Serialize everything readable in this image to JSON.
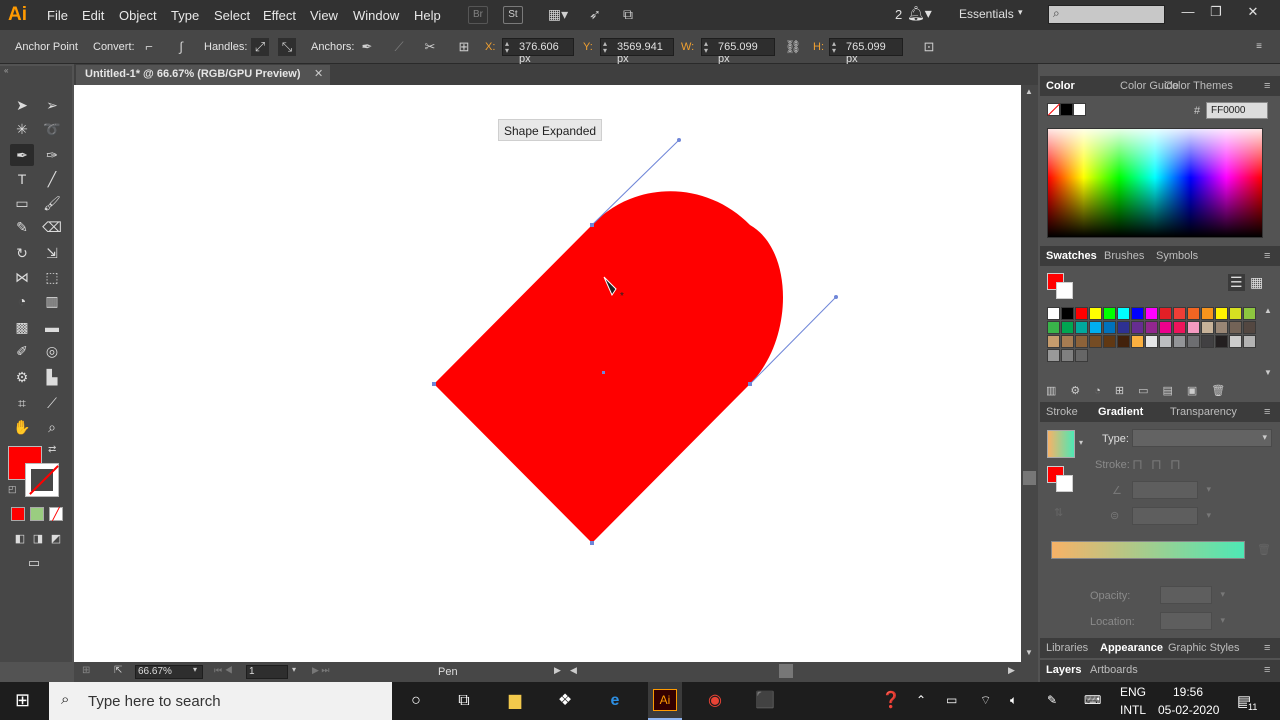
{
  "menubar": {
    "logo": "Ai",
    "items": [
      "File",
      "Edit",
      "Object",
      "Type",
      "Select",
      "Effect",
      "View",
      "Window",
      "Help"
    ],
    "icons": {
      "bridge": "Br",
      "stock": "St"
    },
    "notification_count": "2",
    "workspace": "Essentials",
    "window_controls": [
      "minimize-icon",
      "restore-icon",
      "close-icon"
    ]
  },
  "control": {
    "anchor_point": "Anchor Point",
    "convert_label": "Convert:",
    "handles_label": "Handles:",
    "anchors_label": "Anchors:",
    "x_label": "X:",
    "x_value": "376.606 px",
    "y_label": "Y:",
    "y_value": "3569.941 px",
    "w_label": "W:",
    "w_value": "765.099 px",
    "h_label": "H:",
    "h_value": "765.099 px"
  },
  "document": {
    "tab_title": "Untitled-1* @ 66.67% (RGB/GPU Preview)",
    "tooltip": "Shape Expanded",
    "shape_color": "#ff0000"
  },
  "statusbar": {
    "zoom": "66.67%",
    "artboard": "1",
    "tool": "Pen"
  },
  "color_panel": {
    "tabs": [
      "Color",
      "Color Guide",
      "Color Themes"
    ],
    "hex_label": "#",
    "hex_value": "FF0000"
  },
  "swatches_panel": {
    "tabs": [
      "Swatches",
      "Brushes",
      "Symbols"
    ],
    "colors": [
      "#ffffff",
      "#000000",
      "#ff0000",
      "#ffff00",
      "#00ff00",
      "#00ffff",
      "#0000ff",
      "#ff00ff",
      "#e41f26",
      "#ef3e36",
      "#f26522",
      "#f7941d",
      "#fff200",
      "#d7e021",
      "#8dc63f",
      "#39b54a",
      "#00a651",
      "#00a99d",
      "#00aeef",
      "#0072bc",
      "#2e3192",
      "#662d91",
      "#92278f",
      "#ec008c",
      "#ed145b",
      "#f49ac1",
      "#c7b299",
      "#998675",
      "#736357",
      "#534741",
      "#c69c6d",
      "#a67c52",
      "#8c6239",
      "#754c24",
      "#603813",
      "#42210b",
      "#fbb040",
      "#e6e7e8",
      "#bcbec0",
      "#939598",
      "#6d6e71",
      "#414042",
      "#231f20",
      "#cccccc",
      "#b3b3b3",
      "#999999",
      "#808080",
      "#666666"
    ]
  },
  "gradient_panel": {
    "tabs": [
      "Stroke",
      "Gradient",
      "Transparency"
    ],
    "type_label": "Type:",
    "stroke_label": "Stroke:",
    "opacity_label": "Opacity:",
    "location_label": "Location:",
    "gradient_start": "#f7b267",
    "gradient_end": "#4ee8b5"
  },
  "bottom_panels": {
    "tabs1": [
      "Libraries",
      "Appearance",
      "Graphic Styles"
    ],
    "tabs2": [
      "Layers",
      "Artboards"
    ]
  },
  "taskbar": {
    "search_placeholder": "Type here to search",
    "lang": "ENG",
    "layout": "INTL",
    "time": "19:56",
    "date": "05-02-2020",
    "notifications": "11"
  }
}
